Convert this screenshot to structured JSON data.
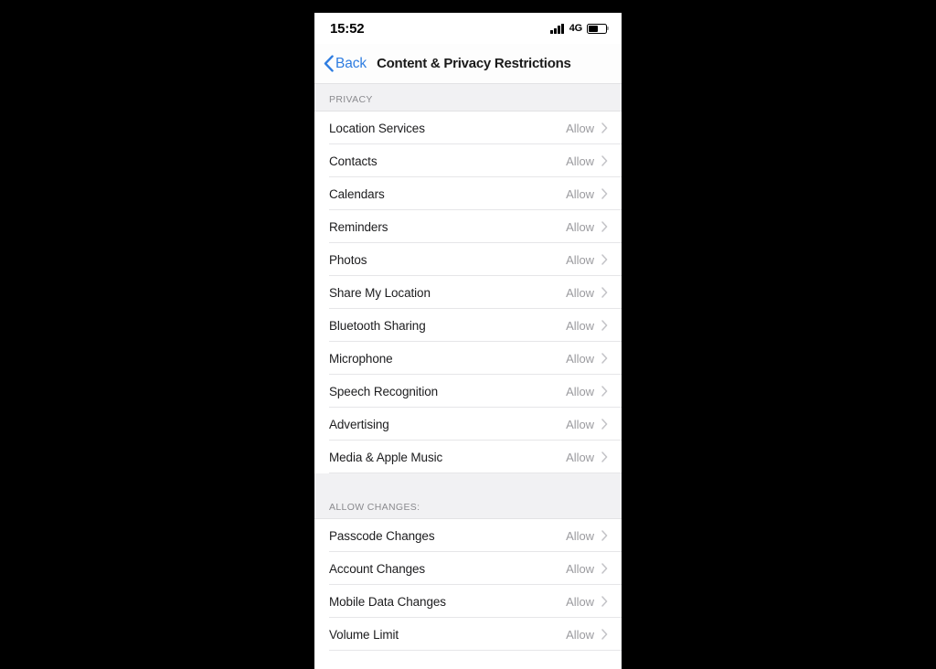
{
  "status_bar": {
    "time": "15:52",
    "network_type": "4G",
    "signal_icon": "signal-bars-icon",
    "battery_icon": "battery-icon",
    "signal_bars_filled": 4,
    "battery_level_percent": 55
  },
  "nav_bar": {
    "back_label": "Back",
    "back_icon": "chevron-left-icon",
    "title": "Content & Privacy Restrictions"
  },
  "colors": {
    "accent_blue": "#2f7de1",
    "value_gray": "#9b9b9f",
    "header_gray": "#8a8a8e",
    "section_bg": "#f1f1f3",
    "separator": "#e6e6e8",
    "row_bg": "#ffffff",
    "letterbox": "#000000"
  },
  "sections": [
    {
      "header": "PRIVACY",
      "rows": [
        {
          "label": "Location Services",
          "value": "Allow",
          "disclosure_icon": "chevron-right-icon"
        },
        {
          "label": "Contacts",
          "value": "Allow",
          "disclosure_icon": "chevron-right-icon"
        },
        {
          "label": "Calendars",
          "value": "Allow",
          "disclosure_icon": "chevron-right-icon"
        },
        {
          "label": "Reminders",
          "value": "Allow",
          "disclosure_icon": "chevron-right-icon"
        },
        {
          "label": "Photos",
          "value": "Allow",
          "disclosure_icon": "chevron-right-icon"
        },
        {
          "label": "Share My Location",
          "value": "Allow",
          "disclosure_icon": "chevron-right-icon"
        },
        {
          "label": "Bluetooth Sharing",
          "value": "Allow",
          "disclosure_icon": "chevron-right-icon"
        },
        {
          "label": "Microphone",
          "value": "Allow",
          "disclosure_icon": "chevron-right-icon"
        },
        {
          "label": "Speech Recognition",
          "value": "Allow",
          "disclosure_icon": "chevron-right-icon"
        },
        {
          "label": "Advertising",
          "value": "Allow",
          "disclosure_icon": "chevron-right-icon"
        },
        {
          "label": "Media & Apple Music",
          "value": "Allow",
          "disclosure_icon": "chevron-right-icon"
        }
      ]
    },
    {
      "header": "ALLOW CHANGES:",
      "rows": [
        {
          "label": "Passcode Changes",
          "value": "Allow",
          "disclosure_icon": "chevron-right-icon"
        },
        {
          "label": "Account Changes",
          "value": "Allow",
          "disclosure_icon": "chevron-right-icon"
        },
        {
          "label": "Mobile Data Changes",
          "value": "Allow",
          "disclosure_icon": "chevron-right-icon"
        },
        {
          "label": "Volume Limit",
          "value": "Allow",
          "disclosure_icon": "chevron-right-icon"
        }
      ]
    }
  ]
}
